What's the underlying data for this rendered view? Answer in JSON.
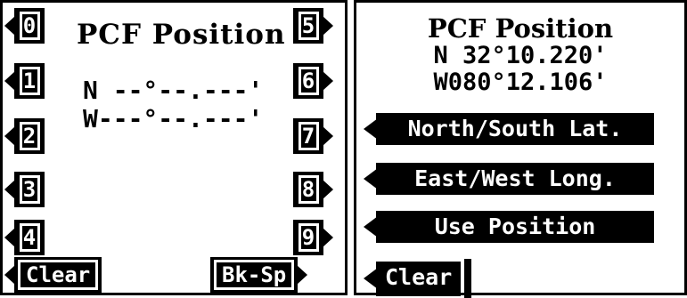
{
  "left": {
    "title": "PCF Position",
    "north_line": "N --°--.---'",
    "west_line": "W---°--.---'",
    "keys_left": [
      "0",
      "1",
      "2",
      "3",
      "4"
    ],
    "keys_right": [
      "5",
      "6",
      "7",
      "8",
      "9"
    ],
    "clear_label": "Clear",
    "backspace_label": "Bk-Sp"
  },
  "right": {
    "title": "PCF Position",
    "latitude": "N 32°10.220'",
    "longitude": "W080°12.106'",
    "options": [
      "North/South Lat.",
      "East/West Long.",
      "Use Position",
      "Clear"
    ]
  }
}
